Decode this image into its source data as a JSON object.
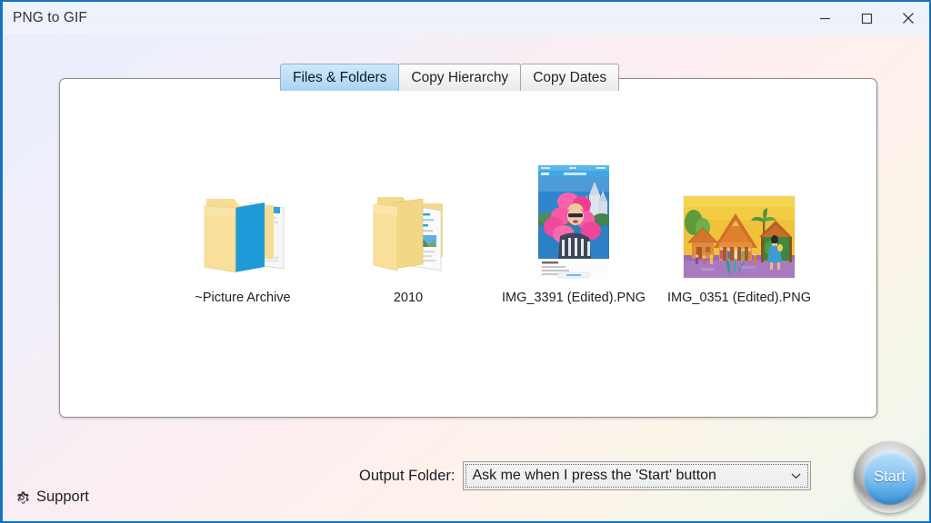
{
  "window": {
    "title": "PNG to GIF",
    "controls": [
      {
        "name": "minimize",
        "icon": "minimize-icon"
      },
      {
        "name": "maximize",
        "icon": "maximize-icon"
      },
      {
        "name": "close",
        "icon": "close-icon"
      }
    ]
  },
  "tabs": [
    {
      "label": "Files & Folders",
      "active": true
    },
    {
      "label": "Copy Hierarchy",
      "active": false
    },
    {
      "label": "Copy Dates",
      "active": false
    }
  ],
  "file_list": [
    {
      "label": "~Picture Archive",
      "icon": "folder-open-blue-icon",
      "type": "folder"
    },
    {
      "label": "2010",
      "icon": "folder-open-yellow-icon",
      "type": "folder"
    },
    {
      "label": "IMG_3391 (Edited).PNG",
      "icon": "image-thumbnail-portrait",
      "type": "image"
    },
    {
      "label": "IMG_0351 (Edited).PNG",
      "icon": "image-thumbnail-landscape",
      "type": "image"
    }
  ],
  "output": {
    "label": "Output Folder:",
    "selected": "Ask me when I press the 'Start' button",
    "arrow_icon": "chevron-down-icon"
  },
  "start_button": {
    "label": "Start"
  },
  "support": {
    "label": "Support",
    "icon": "gear-icon"
  },
  "colors": {
    "accent_blue": "#1573c4",
    "tab_active": "#a9d4f3",
    "folder_yellow": "#f7de8b",
    "folder_blue": "#1e9bd7",
    "panel_background": "#ffffff"
  }
}
